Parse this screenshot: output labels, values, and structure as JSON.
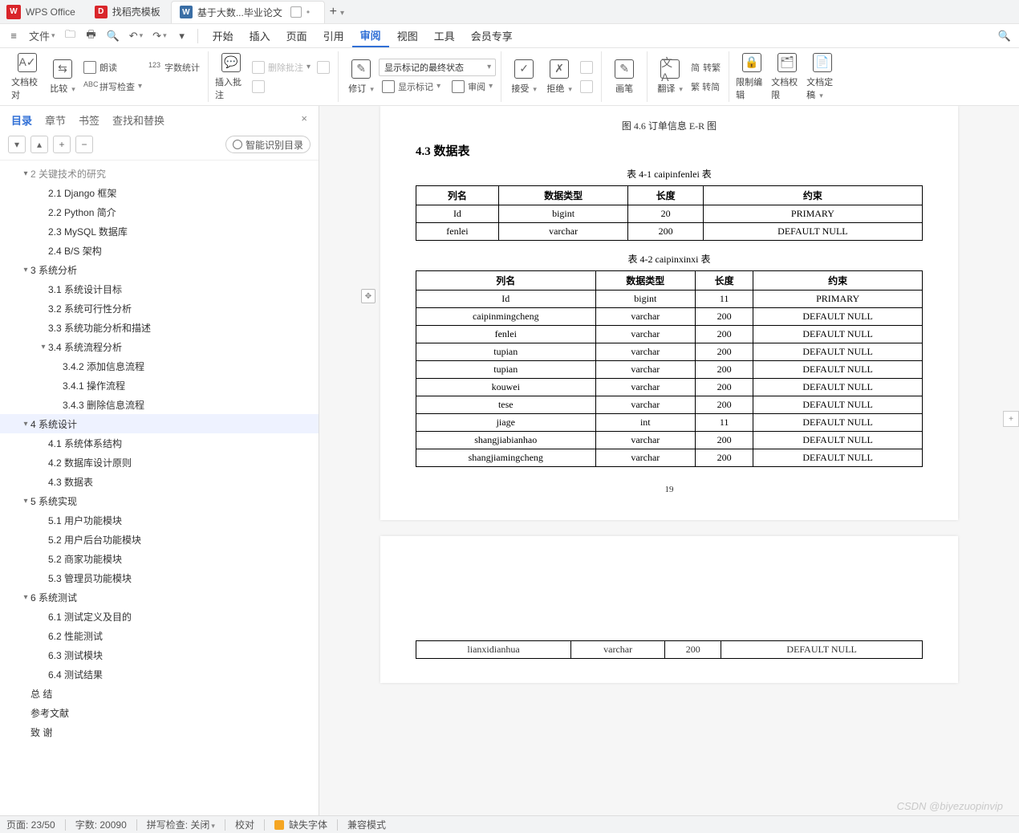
{
  "titlebar": {
    "app": "WPS Office",
    "tabs": [
      {
        "icon": "red",
        "label": "找稻壳模板"
      },
      {
        "icon": "blue",
        "label": "基于大数...毕业论文",
        "active": true
      }
    ],
    "add": "+"
  },
  "qa": {
    "menu_ico": "≡",
    "file": "文件",
    "save": "🖫",
    "print": "⎙",
    "preview": "⤾",
    "undo": "↶",
    "redo": "↷",
    "menus": [
      "开始",
      "插入",
      "页面",
      "引用",
      "审阅",
      "视图",
      "工具",
      "会员专享"
    ],
    "active_menu_index": 4
  },
  "ribbon": {
    "g1": {
      "proof": "文档校对",
      "compare": "比较",
      "read": "朗读",
      "wordcount": "字数统计",
      "spell": "拼写检查",
      "abc": "ABC",
      "n123": "123"
    },
    "g2": {
      "insert": "插入批注",
      "delete": "删除批注"
    },
    "g3": {
      "revise": "修订",
      "show_markup": "显示标记的最终状态",
      "show_marks": "显示标记",
      "review_pane": "审阅"
    },
    "g4": {
      "accept": "接受",
      "reject": "拒绝"
    },
    "g5": {
      "ink": "画笔"
    },
    "g6": {
      "translate": "翻译",
      "cn": "简",
      "t2s": "转繁",
      "s2t": "繁 转简"
    },
    "g7": {
      "restrict": "限制编辑",
      "docperm": "文档权限",
      "docfinal": "文档定稿"
    }
  },
  "sidebar": {
    "tabs": [
      "目录",
      "章节",
      "书签",
      "查找和替换"
    ],
    "active_tab": 0,
    "close": "×",
    "btns": {
      "collapse": "▾",
      "up": "▴",
      "plus": "+",
      "minus": "−"
    },
    "smart": "智能识别目录",
    "tree": [
      {
        "t": "2",
        "l": "关键技术的研究",
        "ind": 1,
        "tw": "▾",
        "cutoff": true
      },
      {
        "t": "2.1",
        "l": "Django 框架",
        "ind": 2
      },
      {
        "t": "2.2",
        "l": "Python 简介",
        "ind": 2
      },
      {
        "t": "2.3",
        "l": "MySQL 数据库",
        "ind": 2
      },
      {
        "t": "2.4",
        "l": "B/S 架构",
        "ind": 2
      },
      {
        "t": "3",
        "l": "系统分析",
        "ind": 1,
        "tw": "▾"
      },
      {
        "t": "3.1",
        "l": "系统设计目标",
        "ind": 2
      },
      {
        "t": "3.2",
        "l": "系统可行性分析",
        "ind": 2
      },
      {
        "t": "3.3",
        "l": "系统功能分析和描述",
        "ind": 2
      },
      {
        "t": "3.4",
        "l": "系统流程分析",
        "ind": 2,
        "tw": "▾"
      },
      {
        "t": "3.4.2",
        "l": "添加信息流程",
        "ind": 3
      },
      {
        "t": "3.4.1",
        "l": "操作流程",
        "ind": 3
      },
      {
        "t": "3.4.3",
        "l": "删除信息流程",
        "ind": 3
      },
      {
        "t": "4",
        "l": "系统设计",
        "ind": 1,
        "tw": "▾",
        "sel": true
      },
      {
        "t": "4.1",
        "l": "系统体系结构",
        "ind": 2
      },
      {
        "t": "4.2",
        "l": "数据库设计原则",
        "ind": 2
      },
      {
        "t": "4.3",
        "l": "数据表",
        "ind": 2
      },
      {
        "t": "5",
        "l": "系统实现",
        "ind": 1,
        "tw": "▾"
      },
      {
        "t": "5.1",
        "l": "用户功能模块",
        "ind": 2
      },
      {
        "t": "5.2",
        "l": "用户后台功能模块",
        "ind": 2
      },
      {
        "t": "5.2",
        "l": "商家功能模块",
        "ind": 2
      },
      {
        "t": "5.3",
        "l": "管理员功能模块",
        "ind": 2
      },
      {
        "t": "6",
        "l": "系统测试",
        "ind": 1,
        "tw": "▾"
      },
      {
        "t": "6.1",
        "l": "测试定义及目的",
        "ind": 2
      },
      {
        "t": "6.2",
        "l": "性能测试",
        "ind": 2
      },
      {
        "t": "6.3",
        "l": "测试模块",
        "ind": 2
      },
      {
        "t": "6.4",
        "l": "测试结果",
        "ind": 2
      },
      {
        "t": "",
        "l": "总  结",
        "ind": 1
      },
      {
        "t": "",
        "l": "参考文献",
        "ind": 1
      },
      {
        "t": "",
        "l": "致  谢",
        "ind": 1
      }
    ]
  },
  "doc": {
    "fig_cut": "图 4.6 订单信息 E-R 图",
    "h43": "4.3  数据表",
    "cap1": "表 4-1 caipinfenlei 表",
    "cap2": "表 4-2 caipinxinxi 表",
    "headers": [
      "列名",
      "数据类型",
      "长度",
      "约束"
    ],
    "t1": [
      [
        "Id",
        "bigint",
        "20",
        "PRIMARY"
      ],
      [
        "fenlei",
        "varchar",
        "200",
        "DEFAULT NULL"
      ]
    ],
    "t2": [
      [
        "Id",
        "bigint",
        "11",
        "PRIMARY"
      ],
      [
        "caipinmingcheng",
        "varchar",
        "200",
        "DEFAULT NULL"
      ],
      [
        "fenlei",
        "varchar",
        "200",
        "DEFAULT NULL"
      ],
      [
        "tupian",
        "varchar",
        "200",
        "DEFAULT NULL"
      ],
      [
        "tupian",
        "varchar",
        "200",
        "DEFAULT NULL"
      ],
      [
        "kouwei",
        "varchar",
        "200",
        "DEFAULT NULL"
      ],
      [
        "tese",
        "varchar",
        "200",
        "DEFAULT NULL"
      ],
      [
        "jiage",
        "int",
        "11",
        "DEFAULT NULL"
      ],
      [
        "shangjiabianhao",
        "varchar",
        "200",
        "DEFAULT NULL"
      ],
      [
        "shangjiamingcheng",
        "varchar",
        "200",
        "DEFAULT NULL"
      ]
    ],
    "t3": [
      [
        "lianxidianhua",
        "varchar",
        "200",
        "DEFAULT NULL"
      ]
    ],
    "page_num": "19"
  },
  "status": {
    "page": "页面: 23/50",
    "words": "字数: 20090",
    "spell": "拼写检查: 关闭",
    "proof": "校对",
    "missing": "缺失字体",
    "compat": "兼容模式"
  },
  "watermark": "CSDN @biyezuopinvip"
}
